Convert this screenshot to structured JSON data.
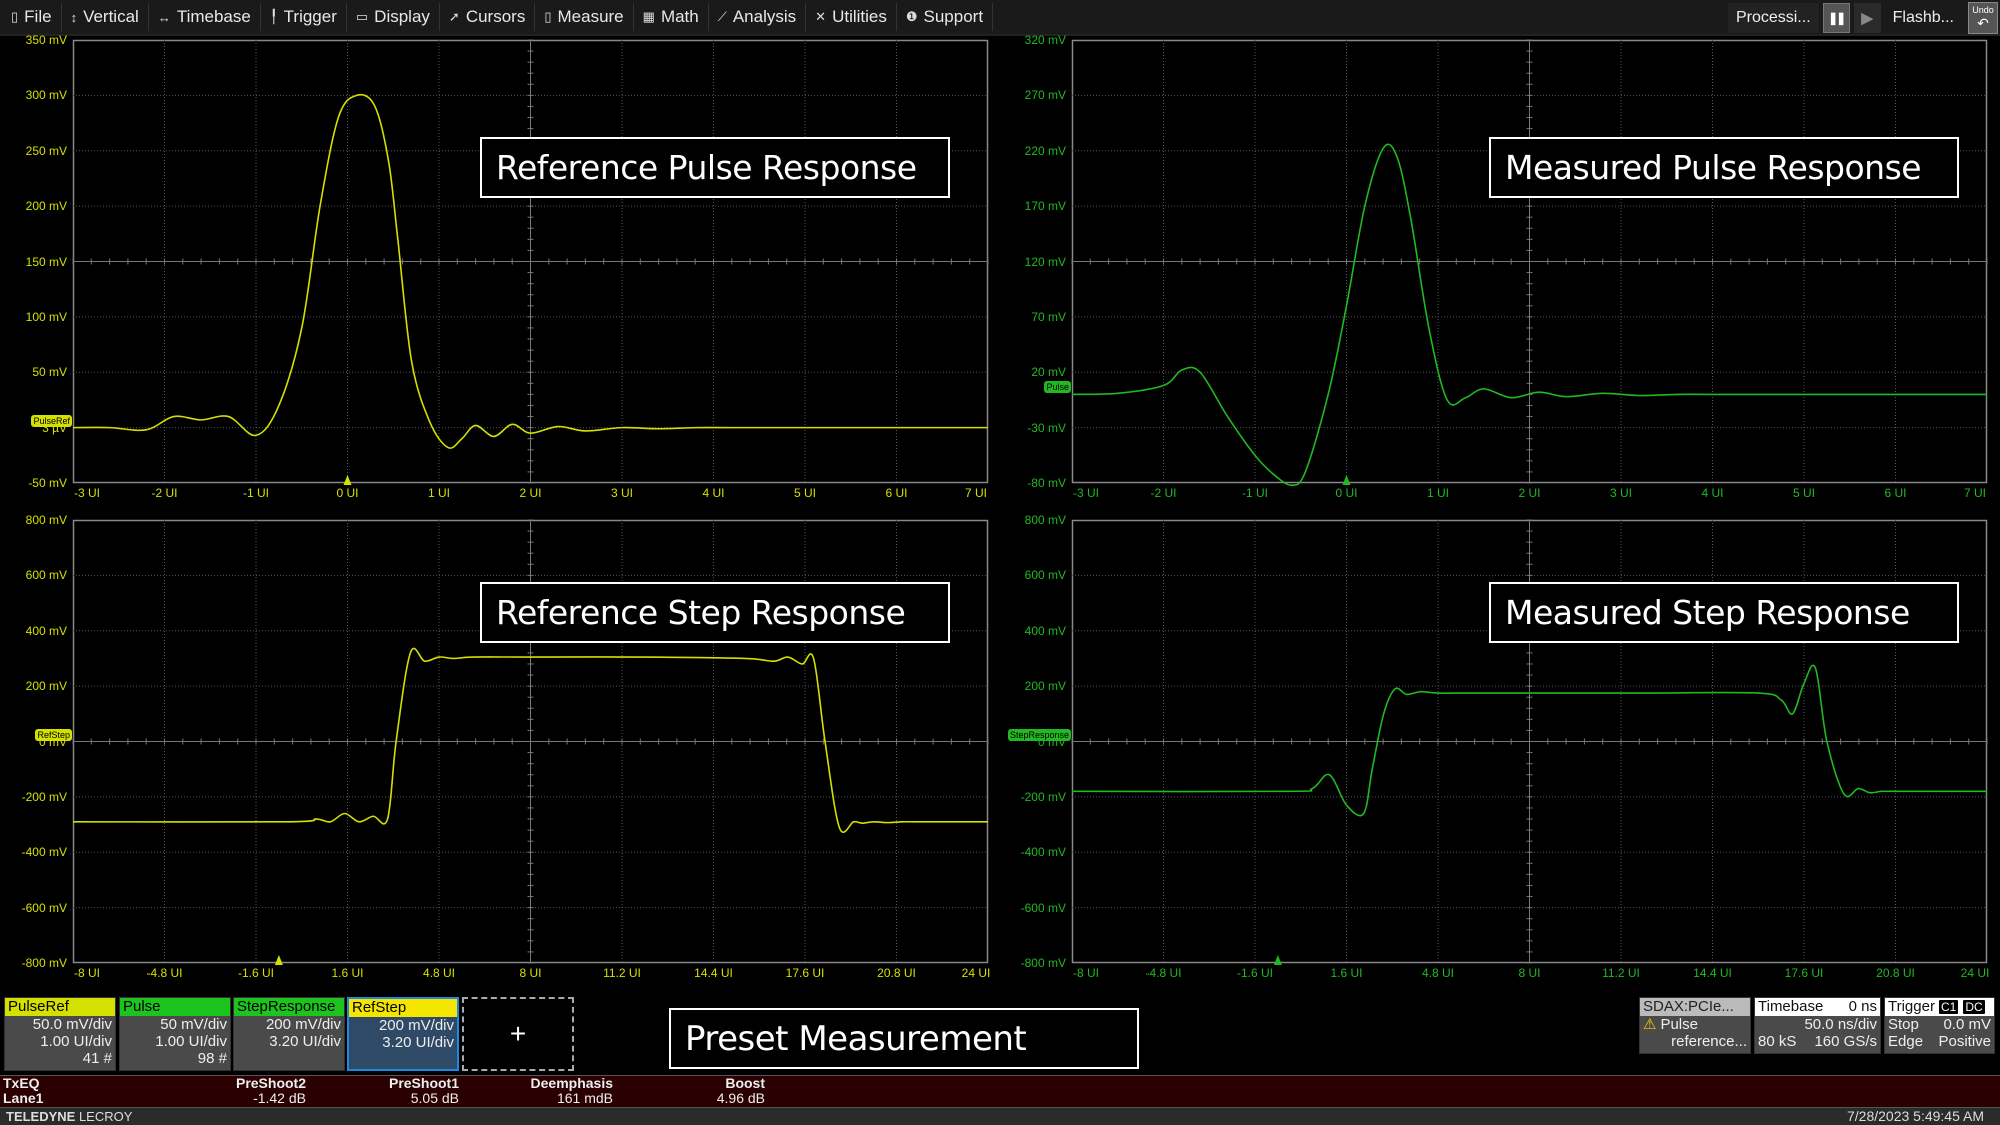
{
  "menubar": {
    "items": [
      {
        "label": "File",
        "icon": "file-icon",
        "glyph": "▯"
      },
      {
        "label": "Vertical",
        "icon": "vertical-arrows-icon",
        "glyph": "↕"
      },
      {
        "label": "Timebase",
        "icon": "horizontal-arrows-icon",
        "glyph": "↔"
      },
      {
        "label": "Trigger",
        "icon": "trigger-icon",
        "glyph": "╿"
      },
      {
        "label": "Display",
        "icon": "display-icon",
        "glyph": "▭"
      },
      {
        "label": "Cursors",
        "icon": "cursor-icon",
        "glyph": "➚"
      },
      {
        "label": "Measure",
        "icon": "measure-icon",
        "glyph": "▯"
      },
      {
        "label": "Math",
        "icon": "calculator-icon",
        "glyph": "▦"
      },
      {
        "label": "Analysis",
        "icon": "analysis-chart-icon",
        "glyph": "⟋"
      },
      {
        "label": "Utilities",
        "icon": "utilities-icon",
        "glyph": "✕"
      },
      {
        "label": "Support",
        "icon": "info-icon",
        "glyph": "❶"
      }
    ],
    "processing_label": "Processi...",
    "pause_glyph": "❚❚",
    "play_glyph": "▶",
    "flashback_label": "Flashb...",
    "undo_label": "Undo",
    "undo_glyph": "↶"
  },
  "panels": [
    {
      "id": "ref-pulse",
      "annotation": "Reference Pulse Response",
      "color": "#d4e000",
      "trace_label": "PulseRef",
      "offset_label": "3 µV",
      "y_ticks": [
        "350 mV",
        "300 mV",
        "250 mV",
        "200 mV",
        "150 mV",
        "100 mV",
        "50 mV",
        "3 µV",
        "-50 mV"
      ],
      "x_ticks": [
        "-3 UI",
        "-2 UI",
        "-1 UI",
        "0 UI",
        "1 UI",
        "2 UI",
        "3 UI",
        "4 UI",
        "5 UI",
        "6 UI",
        "7 UI"
      ]
    },
    {
      "id": "meas-pulse",
      "annotation": "Measured Pulse Response",
      "color": "#22b822",
      "trace_label": "Pulse",
      "offset_label": "",
      "y_ticks": [
        "320 mV",
        "270 mV",
        "220 mV",
        "170 mV",
        "120 mV",
        "70 mV",
        "20 mV",
        "-30 mV",
        "-80 mV"
      ],
      "x_ticks": [
        "-3 UI",
        "-2 UI",
        "-1 UI",
        "0 UI",
        "1 UI",
        "2 UI",
        "3 UI",
        "4 UI",
        "5 UI",
        "6 UI",
        "7 UI"
      ]
    },
    {
      "id": "ref-step",
      "annotation": "Reference Step Response",
      "color": "#d4e000",
      "trace_label": "RefStep",
      "offset_label": "0 mV",
      "y_ticks": [
        "800 mV",
        "600 mV",
        "400 mV",
        "200 mV",
        "0 mV",
        "-200 mV",
        "-400 mV",
        "-600 mV",
        "-800 mV"
      ],
      "x_ticks": [
        "-8 UI",
        "-4.8 UI",
        "-1.6 UI",
        "1.6 UI",
        "4.8 UI",
        "8 UI",
        "11.2 UI",
        "14.4 UI",
        "17.6 UI",
        "20.8 UI",
        "24 UI"
      ]
    },
    {
      "id": "meas-step",
      "annotation": "Measured Step Response",
      "color": "#22b822",
      "trace_label": "StepResponse",
      "offset_label": "0 mV",
      "y_ticks": [
        "800 mV",
        "600 mV",
        "400 mV",
        "200 mV",
        "0 mV",
        "-200 mV",
        "-400 mV",
        "-600 mV",
        "-800 mV"
      ],
      "x_ticks": [
        "-8 UI",
        "-4.8 UI",
        "-1.6 UI",
        "1.6 UI",
        "4.8 UI",
        "8 UI",
        "11.2 UI",
        "14.4 UI",
        "17.6 UI",
        "20.8 UI",
        "24 UI"
      ]
    }
  ],
  "chart_data": [
    {
      "type": "line",
      "title": "Reference Pulse Response",
      "series": [
        {
          "name": "PulseRef",
          "color": "#d4e000",
          "x": [
            -3,
            -2.6,
            -2.2,
            -1.9,
            -1.6,
            -1.3,
            -1.0,
            -0.75,
            -0.5,
            -0.3,
            -0.1,
            0.1,
            0.3,
            0.45,
            0.55,
            0.7,
            0.9,
            1.1,
            1.25,
            1.4,
            1.6,
            1.8,
            2.0,
            2.3,
            2.6,
            3.0,
            3.4,
            3.8,
            4.2,
            5,
            6,
            7
          ],
          "y": [
            0,
            0,
            -2,
            10,
            7,
            10,
            -7,
            20,
            90,
            200,
            280,
            300,
            290,
            240,
            170,
            60,
            5,
            -18,
            -10,
            2,
            -8,
            3,
            -5,
            1,
            -3,
            0,
            -1,
            0,
            0,
            0,
            0,
            0
          ]
        }
      ],
      "xlabel": "UI",
      "ylabel": "mV",
      "xlim": [
        -3,
        7
      ],
      "ylim": [
        -50,
        350
      ],
      "grid": true
    },
    {
      "type": "line",
      "title": "Measured Pulse Response",
      "series": [
        {
          "name": "Pulse",
          "color": "#22b822",
          "x": [
            -3,
            -2.5,
            -2.0,
            -1.8,
            -1.6,
            -1.3,
            -1.0,
            -0.8,
            -0.6,
            -0.45,
            -0.2,
            0.0,
            0.2,
            0.4,
            0.55,
            0.7,
            0.9,
            1.1,
            1.3,
            1.5,
            1.8,
            2.1,
            2.4,
            2.8,
            3.2,
            3.6,
            4,
            5,
            6,
            7
          ],
          "y": [
            0,
            1,
            8,
            22,
            20,
            -20,
            -55,
            -72,
            -82,
            -70,
            0,
            80,
            170,
            222,
            215,
            160,
            60,
            -5,
            -3,
            5,
            -3,
            2,
            -2,
            1,
            -1,
            0,
            0,
            0,
            0,
            0
          ]
        }
      ],
      "xlabel": "UI",
      "ylabel": "mV",
      "xlim": [
        -3,
        7
      ],
      "ylim": [
        -80,
        320
      ],
      "grid": true
    },
    {
      "type": "line",
      "title": "Reference Step Response",
      "series": [
        {
          "name": "RefStep",
          "color": "#d4e000",
          "x": [
            -8,
            -0.5,
            0.5,
            1.0,
            1.5,
            2.0,
            2.5,
            3.0,
            3.3,
            3.8,
            4.3,
            4.8,
            5.3,
            6,
            8,
            12,
            15.5,
            16.5,
            17,
            17.5,
            17.9,
            18.3,
            18.8,
            19.3,
            19.6,
            20,
            20.5,
            21,
            21.5,
            24
          ],
          "y": [
            -290,
            -290,
            -280,
            -290,
            -260,
            -290,
            -270,
            -280,
            0,
            320,
            290,
            305,
            300,
            305,
            305,
            305,
            300,
            290,
            305,
            280,
            300,
            0,
            -310,
            -290,
            -295,
            -290,
            -293,
            -290,
            -290,
            -290
          ]
        }
      ],
      "xlabel": "UI",
      "ylabel": "mV",
      "xlim": [
        -8,
        24
      ],
      "ylim": [
        -800,
        800
      ],
      "grid": true
    },
    {
      "type": "line",
      "title": "Measured Step Response",
      "series": [
        {
          "name": "StepResponse",
          "color": "#22b822",
          "x": [
            -8,
            -0.5,
            0.4,
            1.0,
            1.6,
            2.2,
            2.5,
            2.9,
            3.3,
            3.7,
            4.2,
            4.8,
            6,
            8,
            12,
            16,
            16.8,
            17.2,
            17.6,
            18,
            18.4,
            19,
            19.5,
            19.9,
            20.3,
            20.8,
            24
          ],
          "y": [
            -180,
            -180,
            -170,
            -120,
            -230,
            -260,
            -100,
            100,
            190,
            170,
            180,
            175,
            175,
            175,
            175,
            175,
            150,
            100,
            210,
            265,
            0,
            -190,
            -170,
            -185,
            -180,
            -180,
            -180
          ]
        }
      ],
      "xlabel": "UI",
      "ylabel": "mV",
      "xlim": [
        -8,
        24
      ],
      "ylim": [
        -800,
        800
      ],
      "grid": true
    }
  ],
  "channels": [
    {
      "name": "PulseRef",
      "color": "#d4e000",
      "rows": [
        "50.0 mV/div",
        "1.00 UI/div",
        "41 #"
      ],
      "selected": false
    },
    {
      "name": "Pulse",
      "color": "#1ec41e",
      "rows": [
        "50 mV/div",
        "1.00 UI/div",
        "98 #"
      ],
      "selected": false
    },
    {
      "name": "StepResponse",
      "color": "#1ec41e",
      "rows": [
        "200 mV/div",
        "3.20 UI/div",
        ""
      ],
      "selected": false
    },
    {
      "name": "RefStep",
      "color": "#f5e600",
      "rows": [
        "200 mV/div",
        "3.20 UI/div",
        ""
      ],
      "selected": true
    }
  ],
  "add_channel_label": "+",
  "preset_annotation": "Preset Measurement",
  "sdax": {
    "title": "SDAX:PCIe...",
    "line1": "Pulse",
    "line2": "reference..."
  },
  "timebase": {
    "title": "Timebase",
    "delay": "0 ns",
    "per_div": "50.0 ns/div",
    "samples": "80 kS",
    "rate": "160 GS/s"
  },
  "trigger": {
    "title": "Trigger",
    "source": "C1",
    "coupling": "DC",
    "mode": "Stop",
    "level": "0.0 mV",
    "type": "Edge",
    "slope": "Positive"
  },
  "params": {
    "row_header": "TxEQ",
    "row_label": "Lane1",
    "columns": [
      {
        "name": "PreShoot2",
        "value": "-1.42 dB"
      },
      {
        "name": "PreShoot1",
        "value": "5.05 dB"
      },
      {
        "name": "Deemphasis",
        "value": "161 mdB"
      },
      {
        "name": "Boost",
        "value": "4.96 dB"
      }
    ]
  },
  "footer": {
    "brand_bold": "TELEDYNE",
    "brand_light": " LECROY",
    "datetime": "7/28/2023 5:49:45 AM"
  }
}
